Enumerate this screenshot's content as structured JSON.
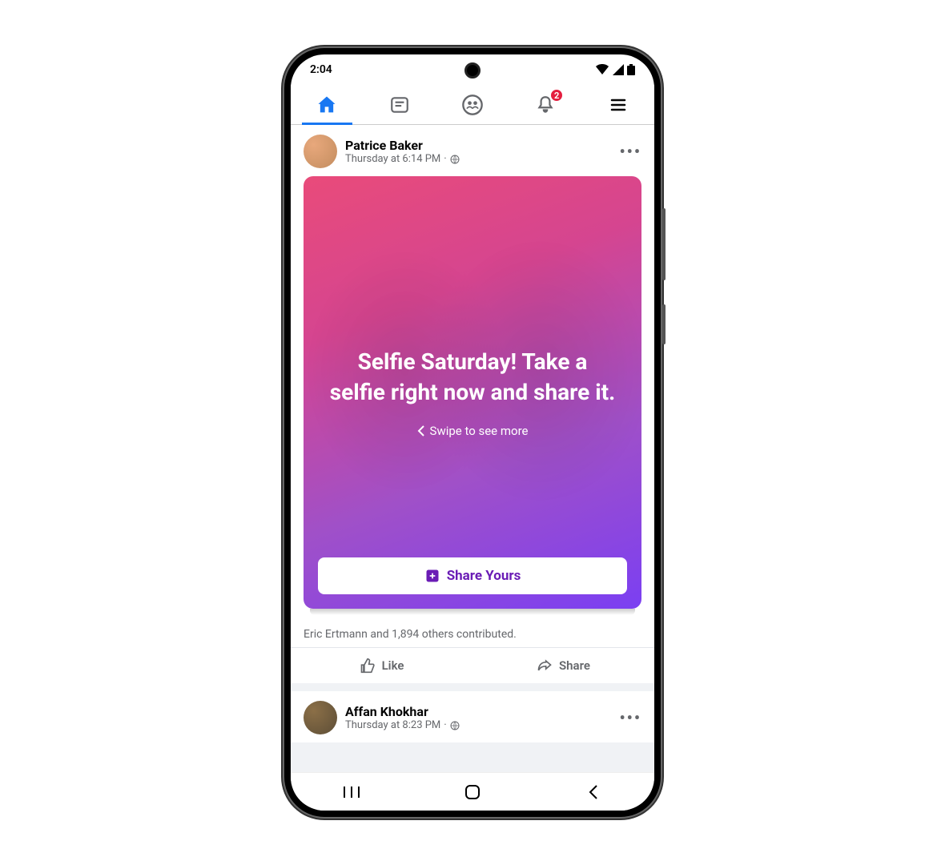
{
  "status": {
    "time": "2:04"
  },
  "tabs": {
    "notif_count": "2"
  },
  "post1": {
    "author": "Patrice Baker",
    "timestamp": "Thursday at 6:14 PM",
    "card_title": "Selfie Saturday! Take a selfie right now and share it.",
    "swipe_hint": "Swipe to see more",
    "share_button": "Share Yours",
    "contributors": "Eric Ertmann and 1,894 others contributed.",
    "like_label": "Like",
    "share_label": "Share"
  },
  "post2": {
    "author": "Affan Khokhar",
    "timestamp": "Thursday at 8:23 PM"
  }
}
